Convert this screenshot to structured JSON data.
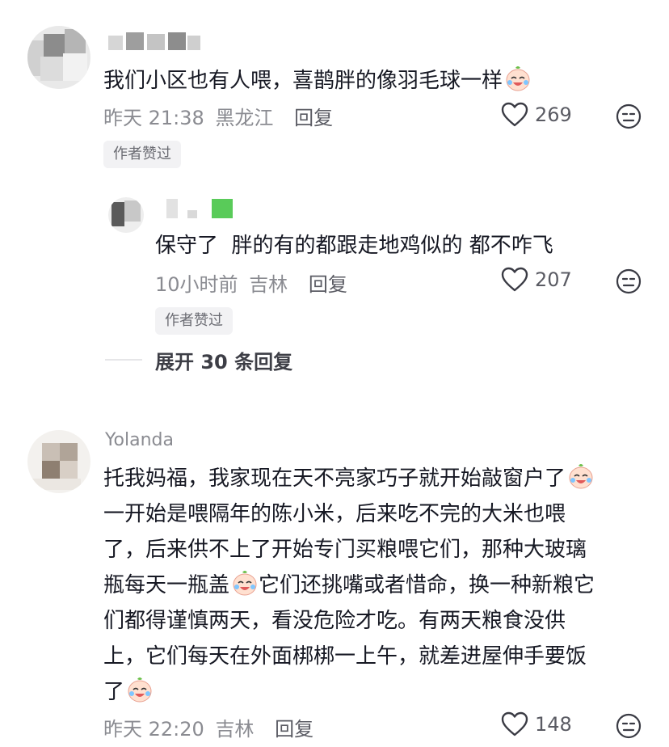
{
  "comments": [
    {
      "text": "我们小区也有人喂，喜鹊胖的像羽毛球一样",
      "time": "昨天 21:38",
      "location": "黑龙江",
      "reply_label": "回复",
      "likes": "269",
      "badge": "作者赞过",
      "emoji": "crying-laughing-face-icon"
    },
    {
      "text": "保守了  胖的有的都跟走地鸡似的 都不咋飞",
      "time": "10小时前",
      "location": "吉林",
      "reply_label": "回复",
      "likes": "207",
      "badge": "作者赞过"
    },
    {
      "username": "Yolanda",
      "text_lines": [
        "托我妈福，我家现在天不亮家巧子就开始敲窗户了",
        "一开始是喂隔年的陈小米，后来吃不完的大米也喂",
        "了，后来供不上了开始专门买粮喂它们，那种大玻璃",
        "瓶每天一瓶盖",
        "它们还挑嘴或者惜命，换一种新粮它",
        "们都得谨慎两天，看没危险才吃。有两天粮食没供",
        "上，它们每天在外面梆梆一上午，就差进屋伸手要饭",
        "了"
      ],
      "time": "昨天 22:20",
      "location": "吉林",
      "reply_label": "回复",
      "likes": "148"
    }
  ],
  "expand_replies": "展开 30 条回复",
  "colors": {
    "text": "#161823",
    "meta": "#8a8b91",
    "badge_bg": "#f2f2f4",
    "green": "#3cc23c"
  }
}
